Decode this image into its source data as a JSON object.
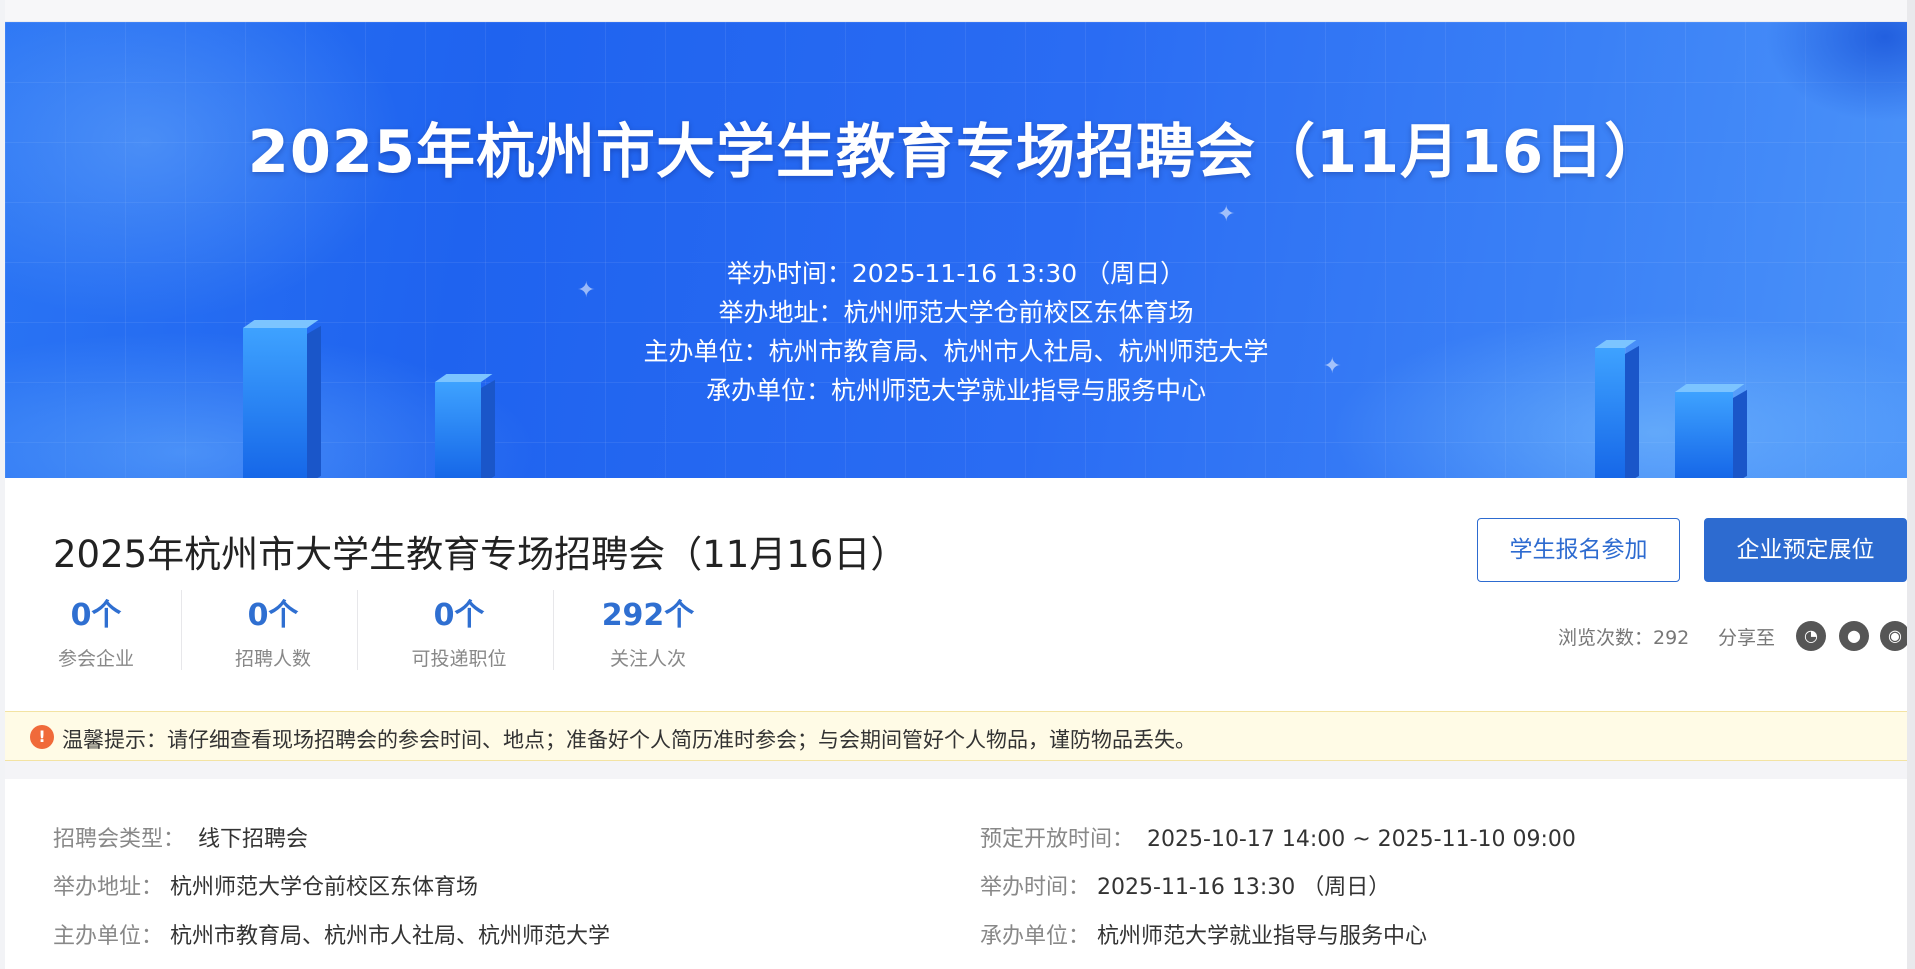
{
  "banner": {
    "title": "2025年杭州市大学生教育专场招聘会（11月16日）",
    "lines": [
      "举办时间：2025-11-16 13:30 （周日）",
      "举办地址：杭州师范大学仓前校区东体育场",
      "主办单位：杭州市教育局、杭州市人社局、杭州师范大学",
      "承办单位：杭州师范大学就业指导与服务中心"
    ]
  },
  "header": {
    "title": "2025年杭州市大学生教育专场招聘会（11月16日）",
    "stats": [
      {
        "num": "0个",
        "label": "参会企业"
      },
      {
        "num": "0个",
        "label": "招聘人数"
      },
      {
        "num": "0个",
        "label": "可投递职位"
      },
      {
        "num": "292个",
        "label": "关注人次"
      }
    ],
    "student_button": "学生报名参加",
    "company_button": "企业预定展位",
    "views": "浏览次数：292",
    "share_label": "分享至"
  },
  "tip": {
    "icon": "!",
    "text": "温馨提示：请仔细查看现场招聘会的参会时间、地点；准备好个人简历准时参会；与会期间管好个人物品，谨防物品丢失。"
  },
  "details": {
    "type_key": "招聘会类型：",
    "type_val": "线下招聘会",
    "address_key": "举办地址：",
    "address_val": "杭州师范大学仓前校区东体育场",
    "host_key": "主办单位：",
    "host_val": "杭州市教育局、杭州市人社局、杭州师范大学",
    "booking_key": "预定开放时间：",
    "booking_val": "2025-10-17 14:00 ~ 2025-11-10 09:00",
    "time_key": "举办时间：",
    "time_val": "2025-11-16 13:30 （周日）",
    "organizer_key": "承办单位：",
    "organizer_val": "杭州师范大学就业指导与服务中心"
  },
  "colors": {
    "accent": "#2d6bd0",
    "stat_number": "#2f6fd1",
    "tip_background": "#fffbe6",
    "tip_icon": "#f06a3a"
  },
  "icons": [
    "warning-icon",
    "wechat-icon",
    "qq-icon",
    "weibo-icon"
  ]
}
